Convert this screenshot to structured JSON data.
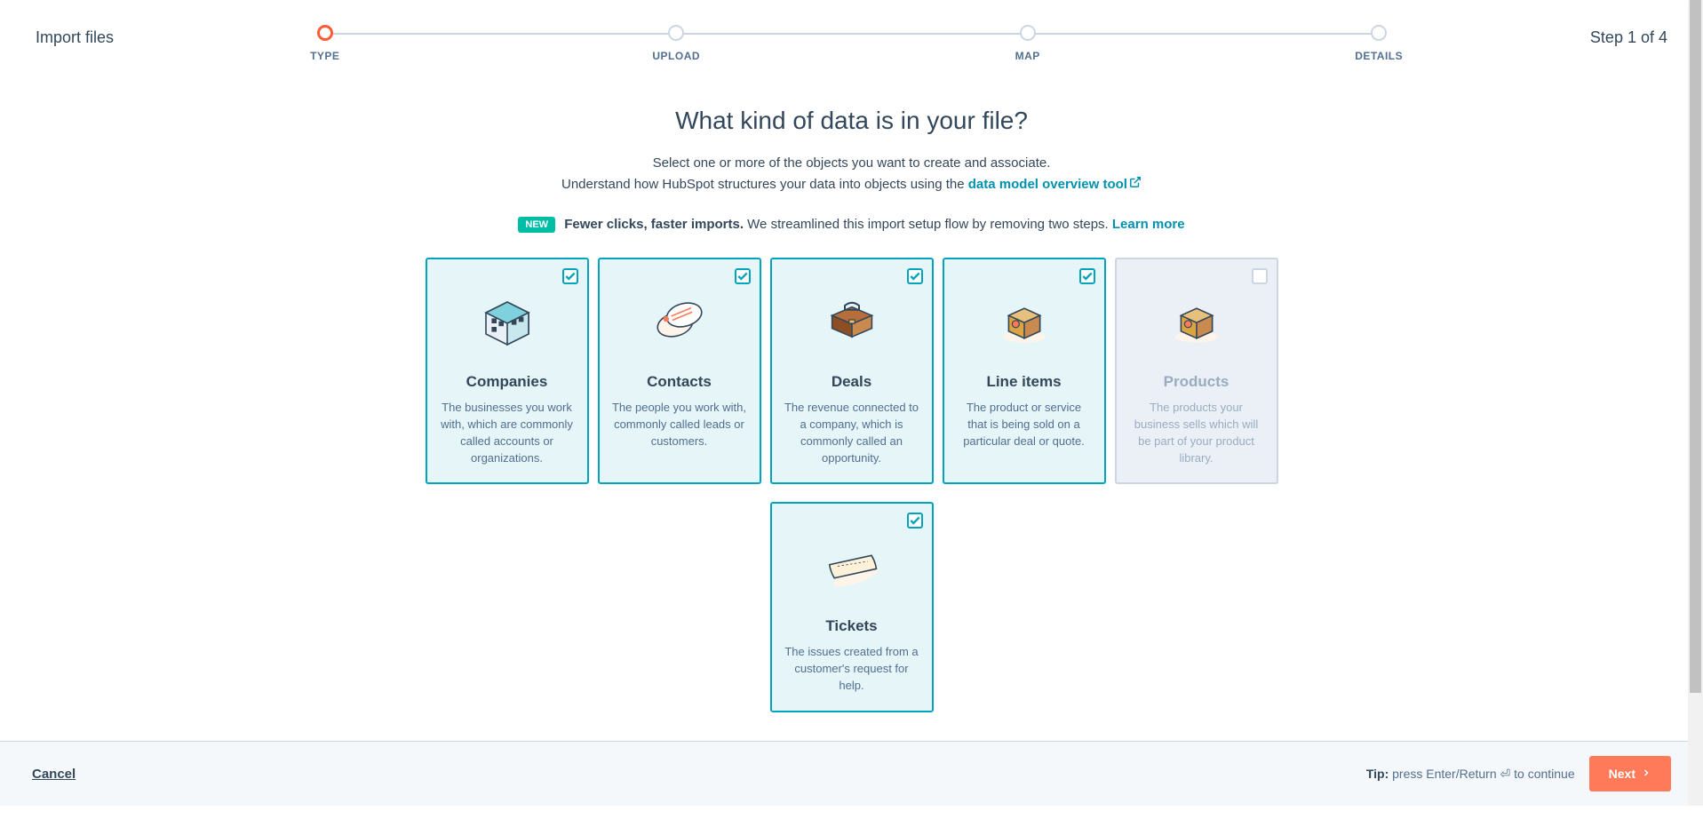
{
  "header": {
    "title": "Import files",
    "step_text": "Step 1 of 4"
  },
  "stepper": {
    "steps": [
      {
        "label": "TYPE"
      },
      {
        "label": "UPLOAD"
      },
      {
        "label": "MAP"
      },
      {
        "label": "DETAILS"
      }
    ]
  },
  "main": {
    "heading": "What kind of data is in your file?",
    "subtitle_line1": "Select one or more of the objects you want to create and associate.",
    "subtitle_line2_prefix": "Understand how HubSpot structures your data into objects using the ",
    "data_model_link": "data model overview tool",
    "banner_new": "NEW",
    "banner_bold": "Fewer clicks, faster imports.",
    "banner_rest": " We streamlined this import setup flow by removing two steps. ",
    "learn_more": "Learn more"
  },
  "cards": [
    {
      "title": "Companies",
      "desc": "The businesses you work with, which are commonly called accounts or organizations.",
      "selected": true,
      "disabled": false
    },
    {
      "title": "Contacts",
      "desc": "The people you work with, commonly called leads or customers.",
      "selected": true,
      "disabled": false
    },
    {
      "title": "Deals",
      "desc": "The revenue connected to a company, which is commonly called an opportunity.",
      "selected": true,
      "disabled": false
    },
    {
      "title": "Line items",
      "desc": "The product or service that is being sold on a particular deal or quote.",
      "selected": true,
      "disabled": false
    },
    {
      "title": "Products",
      "desc": "The products your business sells which will be part of your product library.",
      "selected": false,
      "disabled": true
    },
    {
      "title": "Tickets",
      "desc": "The issues created from a customer's request for help.",
      "selected": true,
      "disabled": false
    }
  ],
  "footer": {
    "cancel": "Cancel",
    "tip_label": "Tip:",
    "tip_text": " press Enter/Return ⏎ to continue",
    "next": "Next"
  }
}
